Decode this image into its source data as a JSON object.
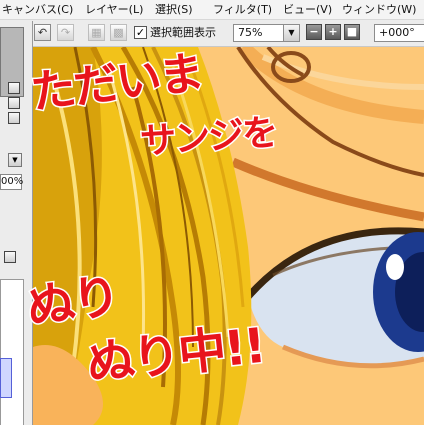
{
  "menu": {
    "items": [
      "キャンバス(C)",
      "レイヤー(L)",
      "選択(S)",
      "フィルタ(T)",
      "ビュー(V)",
      "ウィンドウ(W)"
    ]
  },
  "toolbar": {
    "selection_checkbox_label": "選択範囲表示",
    "selection_checked": true,
    "zoom_value": "75%",
    "rotation_value": "+000°"
  },
  "left_panel": {
    "zoom_percent": "00%"
  },
  "overlay": {
    "line1": "ただいま",
    "line2": "サンジを",
    "line3": "ぬり",
    "line4": "ぬり中!!"
  },
  "colors": {
    "overlay_text": "#e8141c",
    "skin": "#fcc36a",
    "hair": "#f2c21a",
    "iris": "#1c3a8e"
  },
  "icons": {
    "undo": "undo-icon",
    "redo": "redo-icon",
    "deselect": "deselect-icon",
    "invert": "invert-selection-icon",
    "zoom_out": "zoom-out-icon",
    "zoom_in": "zoom-in-icon",
    "zoom_reset": "zoom-reset-icon"
  }
}
